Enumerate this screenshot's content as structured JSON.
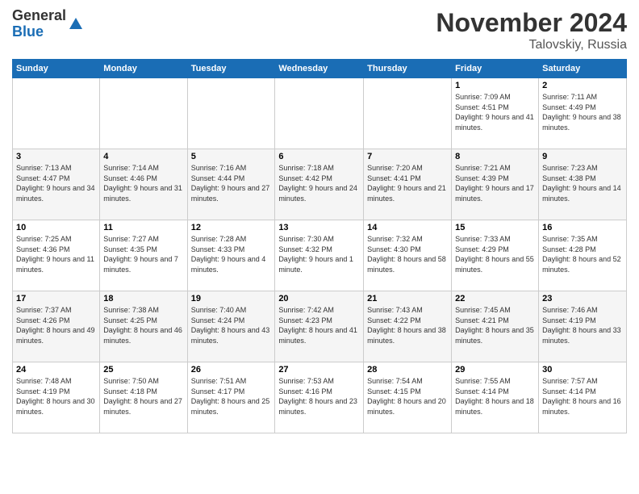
{
  "logo": {
    "line1": "General",
    "line2": "Blue"
  },
  "title": "November 2024",
  "subtitle": "Talovskiy, Russia",
  "days_of_week": [
    "Sunday",
    "Monday",
    "Tuesday",
    "Wednesday",
    "Thursday",
    "Friday",
    "Saturday"
  ],
  "weeks": [
    [
      {
        "day": "",
        "info": ""
      },
      {
        "day": "",
        "info": ""
      },
      {
        "day": "",
        "info": ""
      },
      {
        "day": "",
        "info": ""
      },
      {
        "day": "",
        "info": ""
      },
      {
        "day": "1",
        "info": "Sunrise: 7:09 AM\nSunset: 4:51 PM\nDaylight: 9 hours and 41 minutes."
      },
      {
        "day": "2",
        "info": "Sunrise: 7:11 AM\nSunset: 4:49 PM\nDaylight: 9 hours and 38 minutes."
      }
    ],
    [
      {
        "day": "3",
        "info": "Sunrise: 7:13 AM\nSunset: 4:47 PM\nDaylight: 9 hours and 34 minutes."
      },
      {
        "day": "4",
        "info": "Sunrise: 7:14 AM\nSunset: 4:46 PM\nDaylight: 9 hours and 31 minutes."
      },
      {
        "day": "5",
        "info": "Sunrise: 7:16 AM\nSunset: 4:44 PM\nDaylight: 9 hours and 27 minutes."
      },
      {
        "day": "6",
        "info": "Sunrise: 7:18 AM\nSunset: 4:42 PM\nDaylight: 9 hours and 24 minutes."
      },
      {
        "day": "7",
        "info": "Sunrise: 7:20 AM\nSunset: 4:41 PM\nDaylight: 9 hours and 21 minutes."
      },
      {
        "day": "8",
        "info": "Sunrise: 7:21 AM\nSunset: 4:39 PM\nDaylight: 9 hours and 17 minutes."
      },
      {
        "day": "9",
        "info": "Sunrise: 7:23 AM\nSunset: 4:38 PM\nDaylight: 9 hours and 14 minutes."
      }
    ],
    [
      {
        "day": "10",
        "info": "Sunrise: 7:25 AM\nSunset: 4:36 PM\nDaylight: 9 hours and 11 minutes."
      },
      {
        "day": "11",
        "info": "Sunrise: 7:27 AM\nSunset: 4:35 PM\nDaylight: 9 hours and 7 minutes."
      },
      {
        "day": "12",
        "info": "Sunrise: 7:28 AM\nSunset: 4:33 PM\nDaylight: 9 hours and 4 minutes."
      },
      {
        "day": "13",
        "info": "Sunrise: 7:30 AM\nSunset: 4:32 PM\nDaylight: 9 hours and 1 minute."
      },
      {
        "day": "14",
        "info": "Sunrise: 7:32 AM\nSunset: 4:30 PM\nDaylight: 8 hours and 58 minutes."
      },
      {
        "day": "15",
        "info": "Sunrise: 7:33 AM\nSunset: 4:29 PM\nDaylight: 8 hours and 55 minutes."
      },
      {
        "day": "16",
        "info": "Sunrise: 7:35 AM\nSunset: 4:28 PM\nDaylight: 8 hours and 52 minutes."
      }
    ],
    [
      {
        "day": "17",
        "info": "Sunrise: 7:37 AM\nSunset: 4:26 PM\nDaylight: 8 hours and 49 minutes."
      },
      {
        "day": "18",
        "info": "Sunrise: 7:38 AM\nSunset: 4:25 PM\nDaylight: 8 hours and 46 minutes."
      },
      {
        "day": "19",
        "info": "Sunrise: 7:40 AM\nSunset: 4:24 PM\nDaylight: 8 hours and 43 minutes."
      },
      {
        "day": "20",
        "info": "Sunrise: 7:42 AM\nSunset: 4:23 PM\nDaylight: 8 hours and 41 minutes."
      },
      {
        "day": "21",
        "info": "Sunrise: 7:43 AM\nSunset: 4:22 PM\nDaylight: 8 hours and 38 minutes."
      },
      {
        "day": "22",
        "info": "Sunrise: 7:45 AM\nSunset: 4:21 PM\nDaylight: 8 hours and 35 minutes."
      },
      {
        "day": "23",
        "info": "Sunrise: 7:46 AM\nSunset: 4:19 PM\nDaylight: 8 hours and 33 minutes."
      }
    ],
    [
      {
        "day": "24",
        "info": "Sunrise: 7:48 AM\nSunset: 4:19 PM\nDaylight: 8 hours and 30 minutes."
      },
      {
        "day": "25",
        "info": "Sunrise: 7:50 AM\nSunset: 4:18 PM\nDaylight: 8 hours and 27 minutes."
      },
      {
        "day": "26",
        "info": "Sunrise: 7:51 AM\nSunset: 4:17 PM\nDaylight: 8 hours and 25 minutes."
      },
      {
        "day": "27",
        "info": "Sunrise: 7:53 AM\nSunset: 4:16 PM\nDaylight: 8 hours and 23 minutes."
      },
      {
        "day": "28",
        "info": "Sunrise: 7:54 AM\nSunset: 4:15 PM\nDaylight: 8 hours and 20 minutes."
      },
      {
        "day": "29",
        "info": "Sunrise: 7:55 AM\nSunset: 4:14 PM\nDaylight: 8 hours and 18 minutes."
      },
      {
        "day": "30",
        "info": "Sunrise: 7:57 AM\nSunset: 4:14 PM\nDaylight: 8 hours and 16 minutes."
      }
    ]
  ]
}
